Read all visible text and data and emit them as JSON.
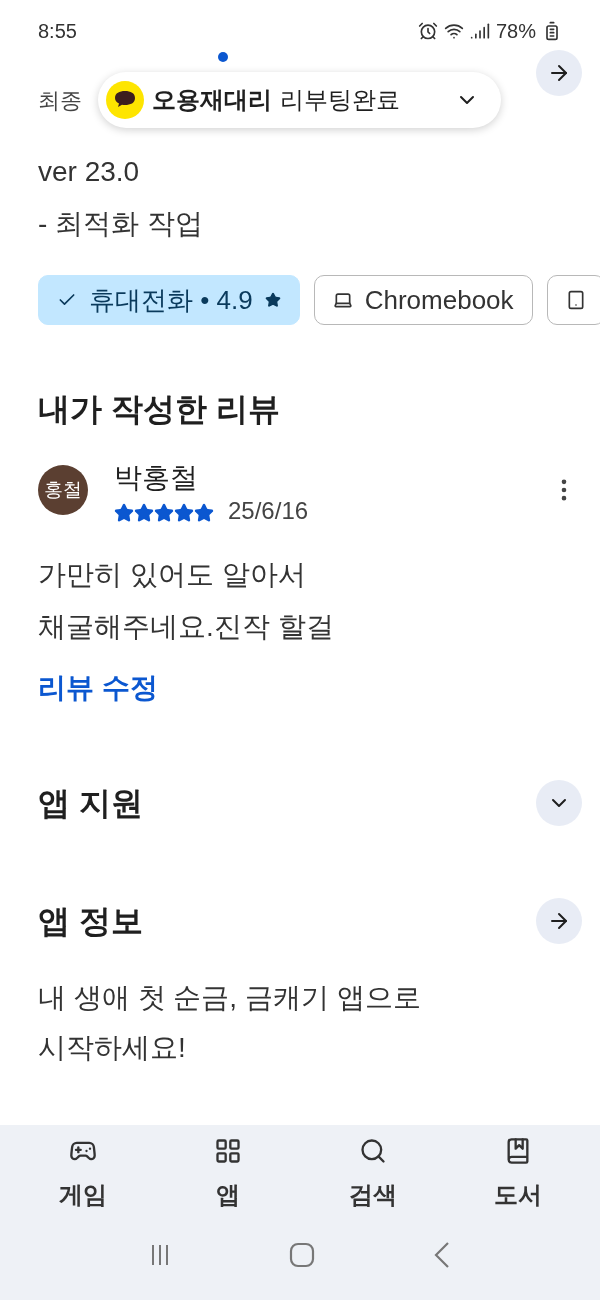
{
  "status_bar": {
    "time": "8:55",
    "battery": "78%"
  },
  "toast": {
    "sender": "오용재대리",
    "message": "리부팅완료"
  },
  "whats_new": {
    "subtitle": "최종",
    "version": "ver 23.0",
    "notes": "- 최적화 작업"
  },
  "device_chips": [
    {
      "label": "휴대전화 • 4.9",
      "selected": true
    },
    {
      "kind": "laptop",
      "label": "Chromebook",
      "selected": false
    },
    {
      "kind": "tablet",
      "selected": false
    }
  ],
  "my_review": {
    "heading": "내가 작성한 리뷰",
    "avatar": "홍철",
    "name": "박홍철",
    "stars": 5,
    "date": "25/6/16",
    "text": "가만히 있어도 알아서\n채굴해주네요.진작 할걸",
    "edit_link": "리뷰 수정"
  },
  "sections": [
    {
      "kind": "expand",
      "title": "앱 지원"
    },
    {
      "kind": "arrow",
      "title": "앱 정보",
      "description": "내 생애 첫 순금, 금캐기 앱으로\n시작하세요!"
    }
  ],
  "bottom_nav": [
    {
      "kind": "games",
      "label": "게임"
    },
    {
      "kind": "apps",
      "label": "앱"
    },
    {
      "kind": "search",
      "label": "검색"
    },
    {
      "kind": "books",
      "label": "도서"
    }
  ]
}
